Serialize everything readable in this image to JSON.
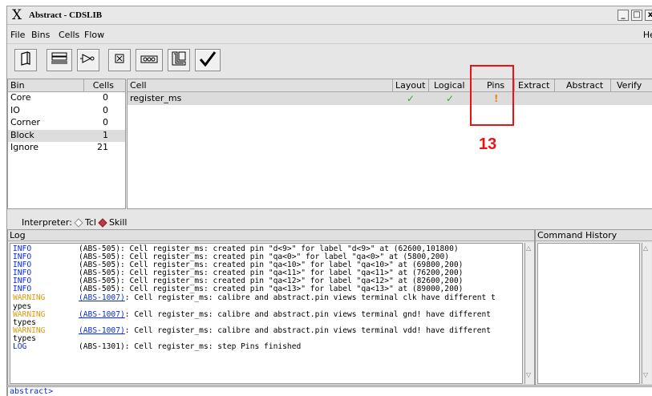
{
  "window": {
    "title": "Abstract - CDSLIB",
    "logo": "X",
    "buttons": [
      "_",
      "□",
      "x"
    ]
  },
  "menu": {
    "items": [
      "File",
      "Bins",
      "Cells",
      "Flow"
    ],
    "help": "Hel"
  },
  "toolbar": {
    "icons": [
      "open-cell-icon",
      "layout-view-icon",
      "logical-view-icon",
      "close-icon",
      "pins-icon",
      "extract-icon",
      "verify-check-icon"
    ]
  },
  "bins": {
    "headers": [
      "Bin",
      "Cells"
    ],
    "rows": [
      {
        "name": "Core",
        "cells": "0"
      },
      {
        "name": "IO",
        "cells": "0"
      },
      {
        "name": "Corner",
        "cells": "0"
      },
      {
        "name": "Block",
        "cells": "1"
      },
      {
        "name": "Ignore",
        "cells": "21"
      }
    ]
  },
  "cells": {
    "headers": [
      "Cell",
      "Layout",
      "Logical",
      "Pins",
      "Extract",
      "Abstract",
      "Verify"
    ],
    "row": {
      "name": "register_ms",
      "layout": "✓",
      "logical": "✓",
      "pins": "!"
    }
  },
  "annotation": {
    "number": "13"
  },
  "interpreter": {
    "label": "Interpreter:",
    "options": [
      "Tcl",
      "Skill"
    ],
    "selected": "Skill"
  },
  "log": {
    "title": "Log",
    "lines": [
      {
        "level": "INFO",
        "code": "",
        "msg": "(ABS-505): Cell register_ms: created pin \"d<9>\" for label \"d<9>\" at (62600,101800)"
      },
      {
        "level": "INFO",
        "code": "",
        "msg": "(ABS-505): Cell register_ms: created pin \"qa<0>\" for label \"qa<0>\" at (5800,200)"
      },
      {
        "level": "INFO",
        "code": "",
        "msg": "(ABS-505): Cell register_ms: created pin \"qa<10>\" for label \"qa<10>\" at (69800,200)"
      },
      {
        "level": "INFO",
        "code": "",
        "msg": "(ABS-505): Cell register_ms: created pin \"qa<11>\" for label \"qa<11>\" at (76200,200)"
      },
      {
        "level": "INFO",
        "code": "",
        "msg": "(ABS-505): Cell register_ms: created pin \"qa<12>\" for label \"qa<12>\" at (82600,200)"
      },
      {
        "level": "INFO",
        "code": "",
        "msg": "(ABS-505): Cell register_ms: created pin \"qa<13>\" for label \"qa<13>\" at (89000,200)"
      },
      {
        "level": "WARNING",
        "code": "(ABS-1007)",
        "msg": ": Cell register_ms: calibre and abstract.pin views terminal clk have different t"
      },
      {
        "level": "ypes",
        "code": "",
        "msg": ""
      },
      {
        "level": "WARNING",
        "code": "(ABS-1007)",
        "msg": ": Cell register_ms: calibre and abstract.pin views terminal gnd! have different"
      },
      {
        "level": "types",
        "code": "",
        "msg": ""
      },
      {
        "level": "WARNING",
        "code": "(ABS-1007)",
        "msg": ": Cell register_ms: calibre and abstract.pin views terminal vdd! have different"
      },
      {
        "level": "types",
        "code": "",
        "msg": ""
      },
      {
        "level": "LOG",
        "code": "",
        "msg": "(ABS-1301): Cell register_ms: step Pins finished"
      }
    ]
  },
  "history": {
    "title": "Command History"
  },
  "prompt": {
    "text": "abstract>"
  }
}
